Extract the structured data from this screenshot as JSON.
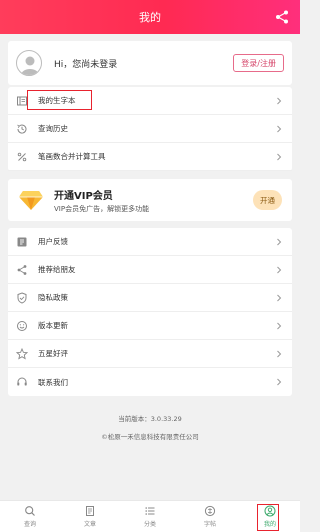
{
  "header": {
    "title": "我的"
  },
  "user": {
    "greeting": "Hi，您尚未登录",
    "login_label": "登录/注册"
  },
  "menu1": [
    {
      "label": "我的生字本",
      "icon": "book-icon"
    },
    {
      "label": "查询历史",
      "icon": "history-icon"
    },
    {
      "label": "笔画数合并计算工具",
      "icon": "percent-icon"
    }
  ],
  "vip": {
    "title": "开通VIP会员",
    "subtitle": "VIP会员免广告，解锁更多功能",
    "button": "开通"
  },
  "menu2": [
    {
      "label": "用户反馈",
      "icon": "feedback-icon"
    },
    {
      "label": "推荐给朋友",
      "icon": "share-icon"
    },
    {
      "label": "隐私政策",
      "icon": "shield-icon"
    },
    {
      "label": "版本更新",
      "icon": "smile-icon"
    },
    {
      "label": "五星好评",
      "icon": "star-icon"
    },
    {
      "label": "联系我们",
      "icon": "headset-icon"
    }
  ],
  "footer": {
    "version": "当前版本：3.0.33.29",
    "company": "©松原一禾信息科技有限责任公司"
  },
  "tabs": [
    {
      "label": "查询",
      "icon": "search-icon"
    },
    {
      "label": "文章",
      "icon": "article-icon"
    },
    {
      "label": "分类",
      "icon": "list-icon"
    },
    {
      "label": "字帖",
      "icon": "copybook-icon"
    },
    {
      "label": "我的",
      "icon": "profile-icon",
      "active": true
    }
  ],
  "colors": {
    "brand": "#ff2a52",
    "active_tab": "#3aa86a",
    "vip_button": "#fde2b8"
  }
}
